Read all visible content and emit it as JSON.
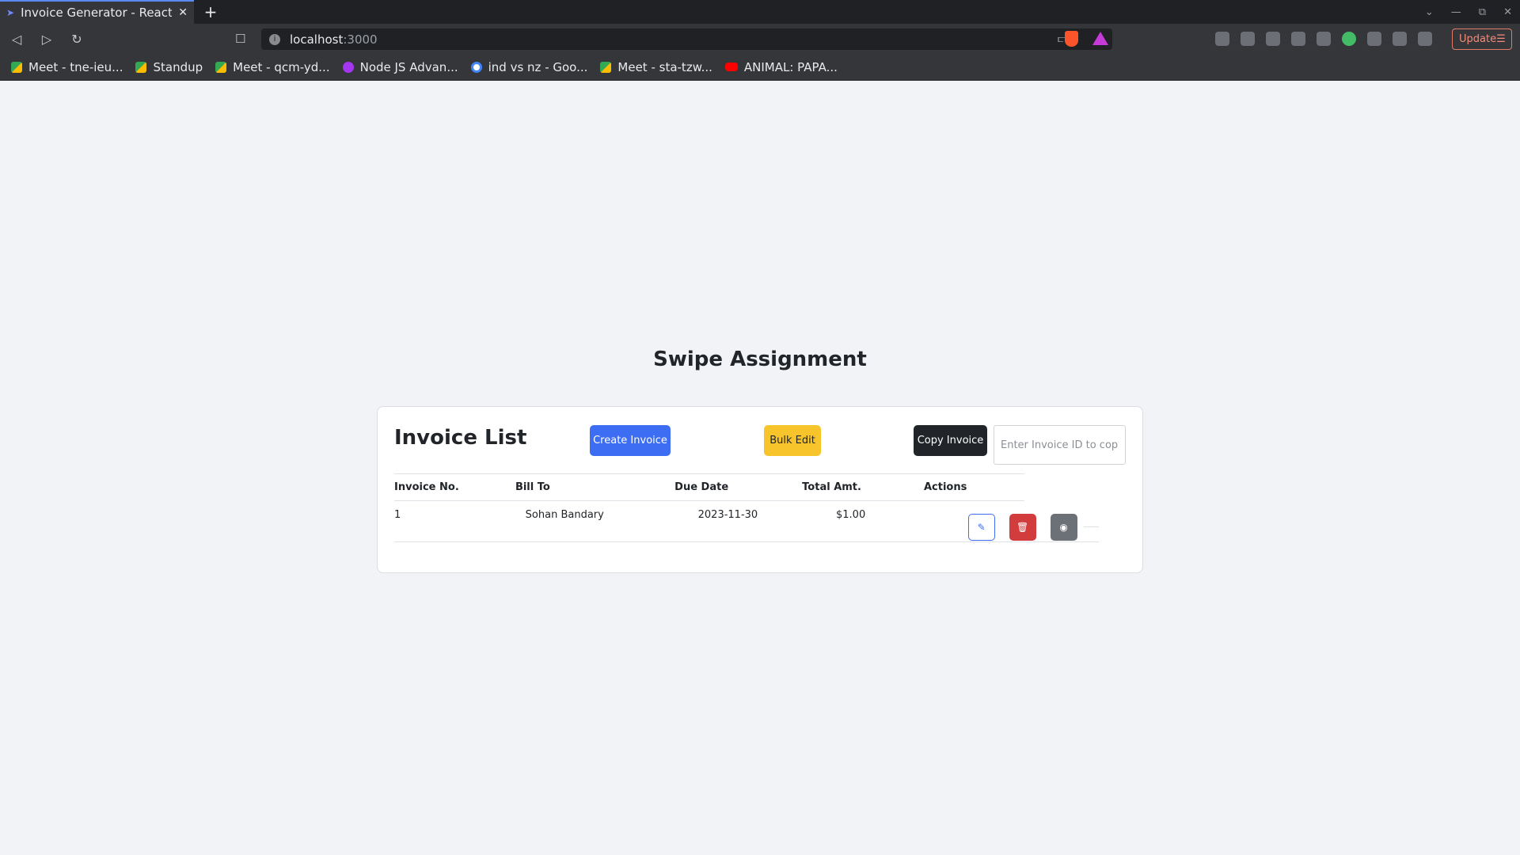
{
  "browser": {
    "tab_title": "Invoice Generator - React /",
    "url_host": "localhost",
    "url_port": ":3000",
    "update_label": "Update",
    "bookmarks": [
      {
        "label": "Meet - tne-ieu...",
        "icon": "meet-icon"
      },
      {
        "label": "Standup",
        "icon": "meet-icon"
      },
      {
        "label": "Meet - qcm-yd...",
        "icon": "meet-icon"
      },
      {
        "label": "Node JS Advan...",
        "icon": "udemy-icon"
      },
      {
        "label": "ind vs nz - Goo...",
        "icon": "google-icon"
      },
      {
        "label": "Meet - sta-tzw...",
        "icon": "meet-icon"
      },
      {
        "label": "ANIMAL: PAPA...",
        "icon": "youtube-icon"
      }
    ]
  },
  "app": {
    "title": "Swipe Assignment"
  },
  "invoice_list": {
    "title": "Invoice List",
    "create_label": "Create Invoice",
    "bulk_edit_label": "Bulk Edit",
    "copy_label": "Copy Invoice",
    "copy_placeholder": "Enter Invoice ID to copy",
    "columns": [
      "Invoice No.",
      "Bill To",
      "Due Date",
      "Total Amt.",
      "Actions"
    ],
    "rows": [
      {
        "invoice_no": "1",
        "bill_to": "Sohan Bandary",
        "due_date": "2023-11-30",
        "total": "$1.00"
      }
    ]
  },
  "colors": {
    "primary": "#3d6df2",
    "warning": "#f7c52b",
    "dark": "#212529",
    "danger": "#d33c3c",
    "secondary": "#6c7077",
    "page_bg": "#f2f3f6"
  }
}
